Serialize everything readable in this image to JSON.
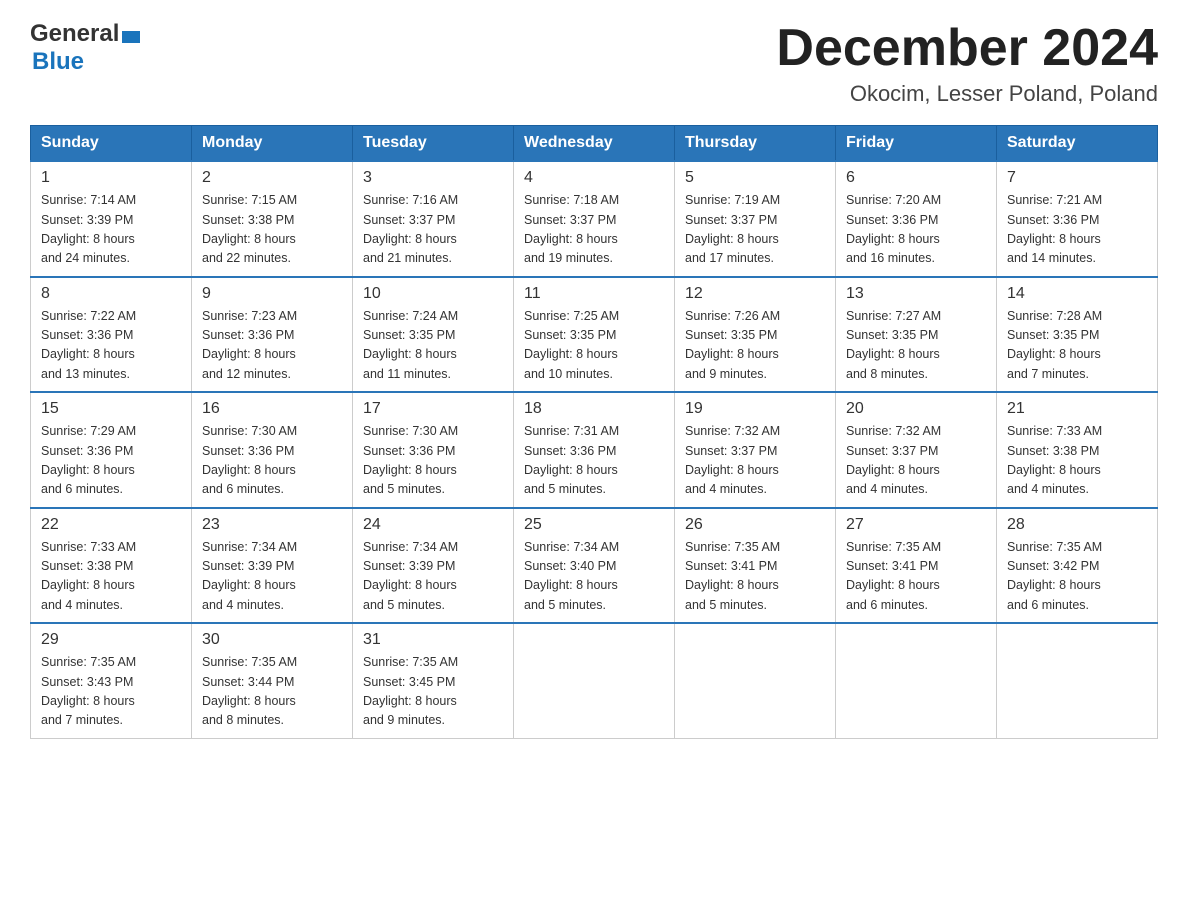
{
  "header": {
    "logo_general": "General",
    "logo_blue": "Blue",
    "month_title": "December 2024",
    "location": "Okocim, Lesser Poland, Poland"
  },
  "calendar": {
    "days_of_week": [
      "Sunday",
      "Monday",
      "Tuesday",
      "Wednesday",
      "Thursday",
      "Friday",
      "Saturday"
    ],
    "weeks": [
      [
        {
          "day": "1",
          "sunrise": "7:14 AM",
          "sunset": "3:39 PM",
          "daylight": "8 hours and 24 minutes."
        },
        {
          "day": "2",
          "sunrise": "7:15 AM",
          "sunset": "3:38 PM",
          "daylight": "8 hours and 22 minutes."
        },
        {
          "day": "3",
          "sunrise": "7:16 AM",
          "sunset": "3:37 PM",
          "daylight": "8 hours and 21 minutes."
        },
        {
          "day": "4",
          "sunrise": "7:18 AM",
          "sunset": "3:37 PM",
          "daylight": "8 hours and 19 minutes."
        },
        {
          "day": "5",
          "sunrise": "7:19 AM",
          "sunset": "3:37 PM",
          "daylight": "8 hours and 17 minutes."
        },
        {
          "day": "6",
          "sunrise": "7:20 AM",
          "sunset": "3:36 PM",
          "daylight": "8 hours and 16 minutes."
        },
        {
          "day": "7",
          "sunrise": "7:21 AM",
          "sunset": "3:36 PM",
          "daylight": "8 hours and 14 minutes."
        }
      ],
      [
        {
          "day": "8",
          "sunrise": "7:22 AM",
          "sunset": "3:36 PM",
          "daylight": "8 hours and 13 minutes."
        },
        {
          "day": "9",
          "sunrise": "7:23 AM",
          "sunset": "3:36 PM",
          "daylight": "8 hours and 12 minutes."
        },
        {
          "day": "10",
          "sunrise": "7:24 AM",
          "sunset": "3:35 PM",
          "daylight": "8 hours and 11 minutes."
        },
        {
          "day": "11",
          "sunrise": "7:25 AM",
          "sunset": "3:35 PM",
          "daylight": "8 hours and 10 minutes."
        },
        {
          "day": "12",
          "sunrise": "7:26 AM",
          "sunset": "3:35 PM",
          "daylight": "8 hours and 9 minutes."
        },
        {
          "day": "13",
          "sunrise": "7:27 AM",
          "sunset": "3:35 PM",
          "daylight": "8 hours and 8 minutes."
        },
        {
          "day": "14",
          "sunrise": "7:28 AM",
          "sunset": "3:35 PM",
          "daylight": "8 hours and 7 minutes."
        }
      ],
      [
        {
          "day": "15",
          "sunrise": "7:29 AM",
          "sunset": "3:36 PM",
          "daylight": "8 hours and 6 minutes."
        },
        {
          "day": "16",
          "sunrise": "7:30 AM",
          "sunset": "3:36 PM",
          "daylight": "8 hours and 6 minutes."
        },
        {
          "day": "17",
          "sunrise": "7:30 AM",
          "sunset": "3:36 PM",
          "daylight": "8 hours and 5 minutes."
        },
        {
          "day": "18",
          "sunrise": "7:31 AM",
          "sunset": "3:36 PM",
          "daylight": "8 hours and 5 minutes."
        },
        {
          "day": "19",
          "sunrise": "7:32 AM",
          "sunset": "3:37 PM",
          "daylight": "8 hours and 4 minutes."
        },
        {
          "day": "20",
          "sunrise": "7:32 AM",
          "sunset": "3:37 PM",
          "daylight": "8 hours and 4 minutes."
        },
        {
          "day": "21",
          "sunrise": "7:33 AM",
          "sunset": "3:38 PM",
          "daylight": "8 hours and 4 minutes."
        }
      ],
      [
        {
          "day": "22",
          "sunrise": "7:33 AM",
          "sunset": "3:38 PM",
          "daylight": "8 hours and 4 minutes."
        },
        {
          "day": "23",
          "sunrise": "7:34 AM",
          "sunset": "3:39 PM",
          "daylight": "8 hours and 4 minutes."
        },
        {
          "day": "24",
          "sunrise": "7:34 AM",
          "sunset": "3:39 PM",
          "daylight": "8 hours and 5 minutes."
        },
        {
          "day": "25",
          "sunrise": "7:34 AM",
          "sunset": "3:40 PM",
          "daylight": "8 hours and 5 minutes."
        },
        {
          "day": "26",
          "sunrise": "7:35 AM",
          "sunset": "3:41 PM",
          "daylight": "8 hours and 5 minutes."
        },
        {
          "day": "27",
          "sunrise": "7:35 AM",
          "sunset": "3:41 PM",
          "daylight": "8 hours and 6 minutes."
        },
        {
          "day": "28",
          "sunrise": "7:35 AM",
          "sunset": "3:42 PM",
          "daylight": "8 hours and 6 minutes."
        }
      ],
      [
        {
          "day": "29",
          "sunrise": "7:35 AM",
          "sunset": "3:43 PM",
          "daylight": "8 hours and 7 minutes."
        },
        {
          "day": "30",
          "sunrise": "7:35 AM",
          "sunset": "3:44 PM",
          "daylight": "8 hours and 8 minutes."
        },
        {
          "day": "31",
          "sunrise": "7:35 AM",
          "sunset": "3:45 PM",
          "daylight": "8 hours and 9 minutes."
        },
        null,
        null,
        null,
        null
      ]
    ],
    "labels": {
      "sunrise": "Sunrise:",
      "sunset": "Sunset:",
      "daylight": "Daylight:"
    }
  }
}
